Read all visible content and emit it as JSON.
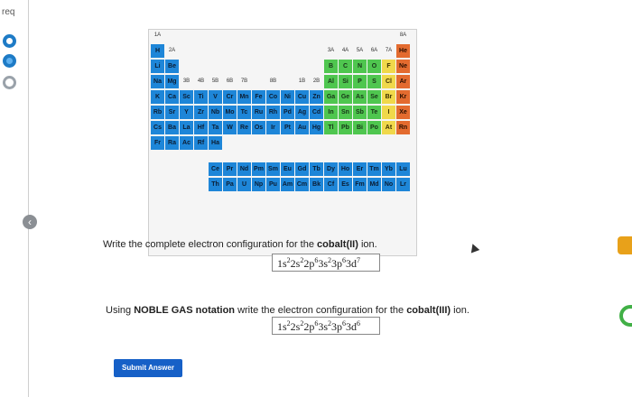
{
  "rail": {
    "req_label": "req"
  },
  "ptable": {
    "group_labels": {
      "1A": "1A",
      "2A": "2A",
      "3A": "3A",
      "4A": "4A",
      "5A": "5A",
      "6A": "6A",
      "7A": "7A",
      "8A": "8A",
      "3B": "3B",
      "4B": "4B",
      "5B": "5B",
      "6B": "6B",
      "7B": "7B",
      "8B": "8B",
      "1B": "1B",
      "2B": "2B"
    },
    "row1": [
      "H",
      "He"
    ],
    "row2": [
      "Li",
      "Be",
      "B",
      "C",
      "N",
      "O",
      "F",
      "Ne"
    ],
    "row3": [
      "Na",
      "Mg",
      "Al",
      "Si",
      "P",
      "S",
      "Cl",
      "Ar"
    ],
    "row4": [
      "K",
      "Ca",
      "Sc",
      "Ti",
      "V",
      "Cr",
      "Mn",
      "Fe",
      "Co",
      "Ni",
      "Cu",
      "Zn",
      "Ga",
      "Ge",
      "As",
      "Se",
      "Br",
      "Kr"
    ],
    "row5": [
      "Rb",
      "Sr",
      "Y",
      "Zr",
      "Nb",
      "Mo",
      "Tc",
      "Ru",
      "Rh",
      "Pd",
      "Ag",
      "Cd",
      "In",
      "Sn",
      "Sb",
      "Te",
      "I",
      "Xe"
    ],
    "row6": [
      "Cs",
      "Ba",
      "La",
      "Hf",
      "Ta",
      "W",
      "Re",
      "Os",
      "Ir",
      "Pt",
      "Au",
      "Hg",
      "Tl",
      "Pb",
      "Bi",
      "Po",
      "At",
      "Rn"
    ],
    "row7": [
      "Fr",
      "Ra",
      "Ac",
      "Rf",
      "Ha"
    ],
    "lanthanides": [
      "Ce",
      "Pr",
      "Nd",
      "Pm",
      "Sm",
      "Eu",
      "Gd",
      "Tb",
      "Dy",
      "Ho",
      "Er",
      "Tm",
      "Yb",
      "Lu"
    ],
    "actinides": [
      "Th",
      "Pa",
      "U",
      "Np",
      "Pu",
      "Am",
      "Cm",
      "Bk",
      "Cf",
      "Es",
      "Fm",
      "Md",
      "No",
      "Lr"
    ]
  },
  "question1": {
    "prefix": "Write the complete electron configuration for the ",
    "species": "cobalt(II)",
    "suffix": " ion."
  },
  "question2": {
    "prefix": "Using ",
    "emphasis": "NOBLE GAS notation",
    "middle": " write the electron configuration for the ",
    "species": "cobalt(III)",
    "suffix": " ion."
  },
  "answers": {
    "a1": [
      "1s",
      "2",
      "2s",
      "2",
      "2p",
      "6",
      "3s",
      "2",
      "3p",
      "6",
      "3d",
      "7"
    ],
    "a2": [
      "1s",
      "2",
      "2s",
      "2",
      "2p",
      "6",
      "3s",
      "2",
      "3p",
      "6",
      "3d",
      "6"
    ]
  },
  "submit": {
    "label": "Submit Answer"
  },
  "colors": {
    "s_block": "#1e86d8",
    "p_block": "#4fc64f",
    "halogen_col": "#f0d84b",
    "noble_col": "#e36b2f",
    "submit_bg": "#1660c7"
  }
}
